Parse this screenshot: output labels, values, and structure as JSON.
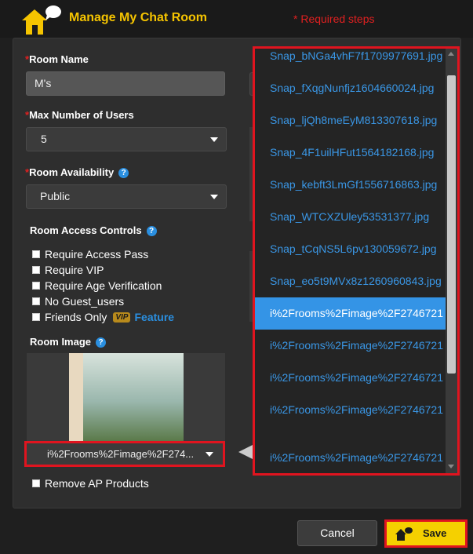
{
  "header": {
    "title": "Manage My Chat Room",
    "required_note": "* Required steps"
  },
  "form": {
    "room_name": {
      "label": "Room Name",
      "value": "M's"
    },
    "max_users": {
      "label": "Max Number of Users",
      "value": "5"
    },
    "availability": {
      "label": "Room Availability",
      "value": "Public"
    },
    "access_controls": {
      "label": "Room Access Controls",
      "options": [
        "Require Access Pass",
        "Require VIP",
        "Require Age Verification",
        "No Guest_users",
        "Friends Only"
      ],
      "vip_badge": "VIP",
      "feature_link": "Feature"
    },
    "room_image": {
      "label": "Room Image",
      "selected": "i%2Frooms%2Fimage%2F274..."
    },
    "remove_ap": "Remove AP Products"
  },
  "dropdown": {
    "items": [
      "Snap_bNGa4vhF7f1709977691.jpg",
      "Snap_fXqgNunfjz1604660024.jpg",
      "Snap_ljQh8meEyM813307618.jpg",
      "Snap_4F1uilHFut1564182168.jpg",
      "Snap_kebft3LmGf1556716863.jpg",
      "Snap_WTCXZUley53531377.jpg",
      "Snap_tCqNS5L6pv130059672.jpg",
      "Snap_eo5t9MVx8z1260960843.jpg",
      "i%2Frooms%2Fimage%2F2746721",
      "i%2Frooms%2Fimage%2F2746721",
      "i%2Frooms%2Fimage%2F2746721",
      "i%2Frooms%2Fimage%2F2746721",
      "i%2Frooms%2Fimage%2F2746721"
    ],
    "selected_index": 8
  },
  "buttons": {
    "cancel": "Cancel",
    "save": "Save"
  },
  "colors": {
    "accent": "#f5c400",
    "required": "#e02020",
    "link": "#3a97e6",
    "highlight": "#e0141f"
  }
}
